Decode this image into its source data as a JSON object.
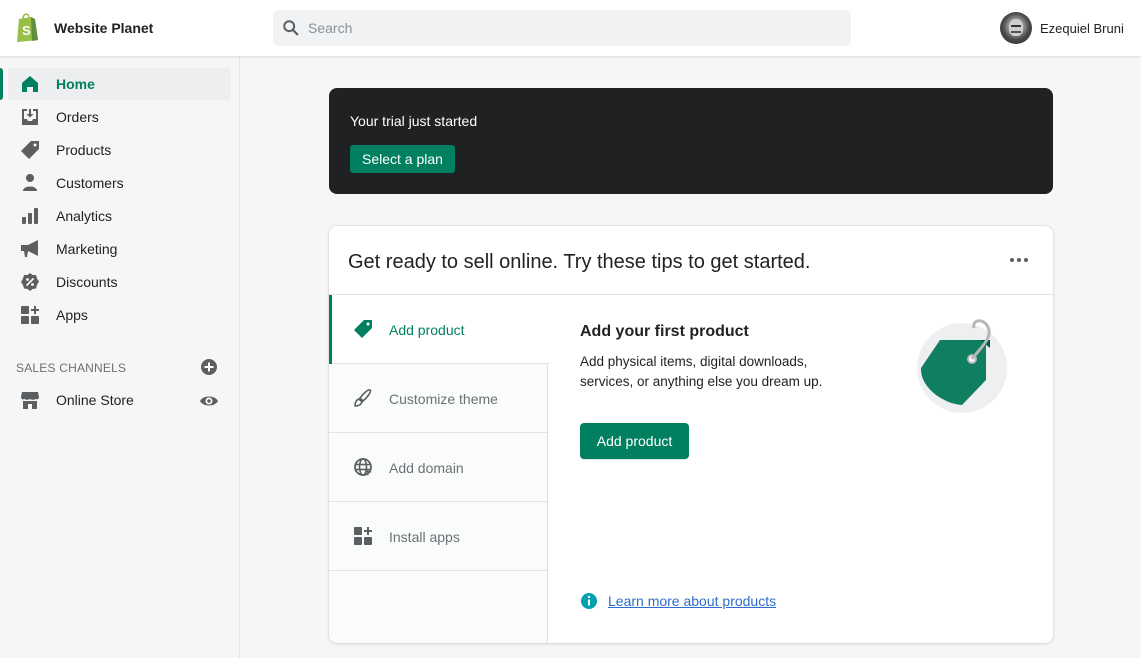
{
  "topbar": {
    "store_name": "Website Planet",
    "search_placeholder": "Search",
    "search_value": "",
    "user_name": "Ezequiel Bruni"
  },
  "sidebar": {
    "items": [
      {
        "label": "Home",
        "icon": "home-icon",
        "active": true
      },
      {
        "label": "Orders",
        "icon": "orders-icon",
        "active": false
      },
      {
        "label": "Products",
        "icon": "tag-icon",
        "active": false
      },
      {
        "label": "Customers",
        "icon": "person-icon",
        "active": false
      },
      {
        "label": "Analytics",
        "icon": "bar-chart-icon",
        "active": false
      },
      {
        "label": "Marketing",
        "icon": "megaphone-icon",
        "active": false
      },
      {
        "label": "Discounts",
        "icon": "discount-icon",
        "active": false
      },
      {
        "label": "Apps",
        "icon": "apps-icon",
        "active": false
      }
    ],
    "sales_channels_title": "SALES CHANNELS",
    "channels": [
      {
        "label": "Online Store",
        "icon": "store-icon"
      }
    ]
  },
  "trial_banner": {
    "text": "Your trial just started",
    "button_label": "Select a plan"
  },
  "setup_card": {
    "title": "Get ready to sell online. Try these tips to get started.",
    "tabs": [
      {
        "label": "Add product",
        "icon": "tag-icon",
        "active": true
      },
      {
        "label": "Customize theme",
        "icon": "brush-icon",
        "active": false
      },
      {
        "label": "Add domain",
        "icon": "globe-icon",
        "active": false
      },
      {
        "label": "Install apps",
        "icon": "apps-icon",
        "active": false
      }
    ],
    "panel": {
      "title": "Add your first product",
      "description": "Add physical items, digital downloads, services, or anything else you dream up.",
      "button_label": "Add product",
      "link_label": "Learn more about products"
    }
  },
  "colors": {
    "brand_green": "#008060",
    "banner_bg": "#202123",
    "link_blue": "#2c6ecb",
    "info_teal": "#00a0ac"
  }
}
